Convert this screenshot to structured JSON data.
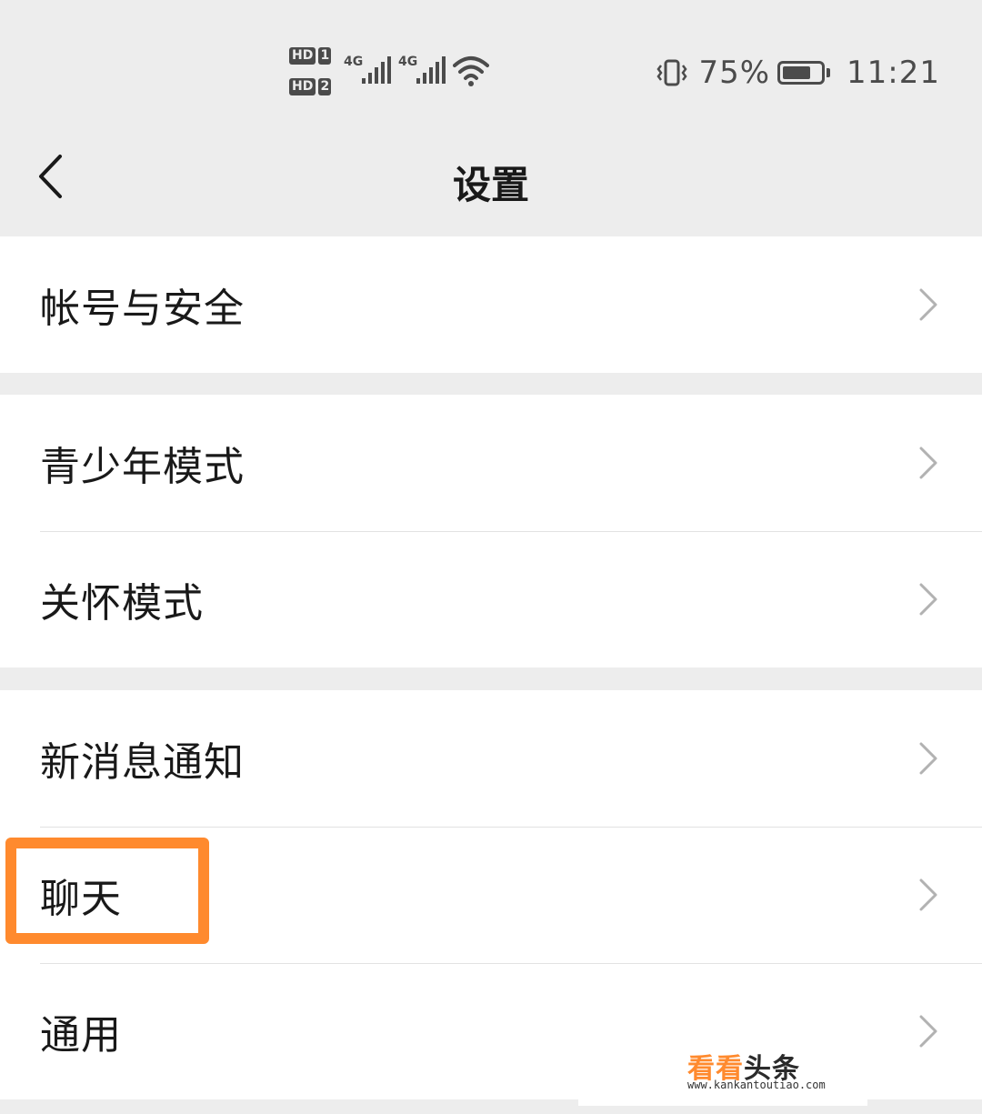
{
  "status_bar": {
    "sim1_hd": "HD",
    "sim1_num": "1",
    "sim2_hd": "HD",
    "sim2_num": "2",
    "net1": "4G",
    "net2": "4G",
    "battery_percent": "75%",
    "battery_level": 0.75,
    "time": "11:21",
    "icons": [
      "signal-icon",
      "wifi-icon",
      "vibrate-icon",
      "battery-icon"
    ]
  },
  "nav": {
    "title": "设置",
    "back_icon": "chevron-left-icon"
  },
  "settings": {
    "groups": [
      {
        "items": [
          {
            "label": "帐号与安全"
          }
        ]
      },
      {
        "items": [
          {
            "label": "青少年模式"
          },
          {
            "label": "关怀模式"
          }
        ]
      },
      {
        "items": [
          {
            "label": "新消息通知"
          },
          {
            "label": "聊天",
            "highlighted": true
          },
          {
            "label": "通用"
          }
        ]
      }
    ]
  },
  "watermark": {
    "brand_part1": "看看",
    "brand_part2": "头条",
    "url": "www.kankantoutiao.com"
  },
  "colors": {
    "background": "#ededed",
    "row_background": "#ffffff",
    "text": "#191919",
    "chevron": "#b2b2b2",
    "highlight": "#ff8a2e",
    "watermark_orange": "#ff8a2e"
  }
}
